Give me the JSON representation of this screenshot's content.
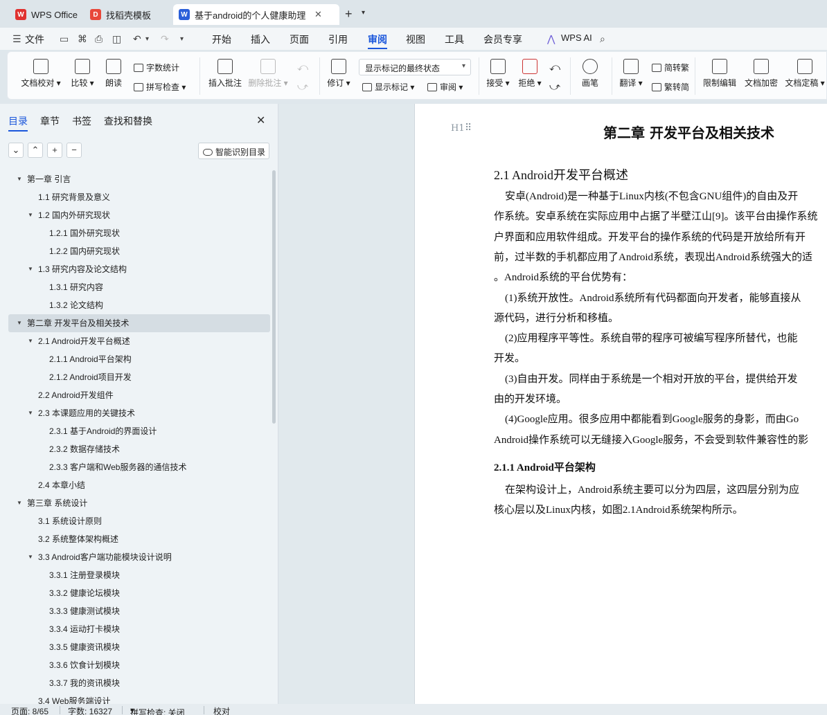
{
  "tabs": [
    {
      "label": "WPS Office",
      "color": "#e0312f"
    },
    {
      "label": "找稻壳模板",
      "color": "#e8483a"
    },
    {
      "label": "基于android的个人健康助理",
      "color": "#2b5fd9"
    }
  ],
  "menu": {
    "file": "文件",
    "items": [
      "开始",
      "插入",
      "页面",
      "引用",
      "审阅",
      "视图",
      "工具",
      "会员专享"
    ],
    "active": "审阅",
    "wps_ai": "WPS AI"
  },
  "ribbon": {
    "doc_check": "文档校对",
    "compare": "比较",
    "read_aloud": "朗读",
    "word_count": "字数统计",
    "spell_check": "拼写检查",
    "insert_comment": "插入批注",
    "delete_comment": "删除批注",
    "track_changes": "修订",
    "display_state": "显示标记的最终状态",
    "show_markup": "显示标记",
    "review": "审阅",
    "accept": "接受",
    "reject": "拒绝",
    "pen": "画笔",
    "translate": "翻译",
    "to_traditional": "简转繁",
    "to_simplified": "繁转简",
    "restrict_edit": "限制编辑",
    "encrypt": "文档加密",
    "finalize": "文档定稿"
  },
  "sidebar": {
    "tabs": [
      "目录",
      "章节",
      "书签",
      "查找和替换"
    ],
    "smart_toc": "智能识别目录",
    "toc": [
      {
        "label": "第一章  引言",
        "level": 1,
        "expand": true
      },
      {
        "label": "1.1  研究背景及意义",
        "level": 2,
        "expand": false
      },
      {
        "label": "1.2  国内外研究现状",
        "level": 2,
        "expand": true
      },
      {
        "label": "1.2.1  国外研究现状",
        "level": 3,
        "expand": false
      },
      {
        "label": "1.2.2  国内研究现状",
        "level": 3,
        "expand": false
      },
      {
        "label": "1.3  研究内容及论文结构",
        "level": 2,
        "expand": true
      },
      {
        "label": "1.3.1  研究内容",
        "level": 3,
        "expand": false
      },
      {
        "label": "1.3.2  论文结构",
        "level": 3,
        "expand": false
      },
      {
        "label": "第二章  开发平台及相关技术",
        "level": 1,
        "expand": true,
        "selected": true
      },
      {
        "label": "2.1 Android开发平台概述",
        "level": 2,
        "expand": true
      },
      {
        "label": "2.1.1 Android平台架构",
        "level": 3,
        "expand": false
      },
      {
        "label": "2.1.2 Android项目开发",
        "level": 3,
        "expand": false
      },
      {
        "label": "2.2 Android开发组件",
        "level": 2,
        "expand": false
      },
      {
        "label": "2.3  本课题应用的关键技术",
        "level": 2,
        "expand": true
      },
      {
        "label": "2.3.1  基于Android的界面设计",
        "level": 3,
        "expand": false
      },
      {
        "label": "2.3.2  数据存储技术",
        "level": 3,
        "expand": false
      },
      {
        "label": "2.3.3  客户端和Web服务器的通信技术",
        "level": 3,
        "expand": false
      },
      {
        "label": "2.4  本章小结",
        "level": 2,
        "expand": false
      },
      {
        "label": "第三章  系统设计",
        "level": 1,
        "expand": true
      },
      {
        "label": "3.1  系统设计原则",
        "level": 2,
        "expand": false
      },
      {
        "label": "3.2  系统整体架构概述",
        "level": 2,
        "expand": false
      },
      {
        "label": "3.3 Android客户端功能模块设计说明",
        "level": 2,
        "expand": true
      },
      {
        "label": "3.3.1  注册登录模块",
        "level": 3,
        "expand": false
      },
      {
        "label": "3.3.2  健康论坛模块",
        "level": 3,
        "expand": false
      },
      {
        "label": "3.3.3  健康测试模块",
        "level": 3,
        "expand": false
      },
      {
        "label": "3.3.4  运动打卡模块",
        "level": 3,
        "expand": false
      },
      {
        "label": "3.3.5  健康资讯模块",
        "level": 3,
        "expand": false
      },
      {
        "label": "3.3.6  饮食计划模块",
        "level": 3,
        "expand": false
      },
      {
        "label": "3.3.7  我的资讯模块",
        "level": 3,
        "expand": false
      },
      {
        "label": "3.4 Web服务端设计",
        "level": 2,
        "expand": false
      }
    ]
  },
  "document": {
    "heading_mark": "H1",
    "chapter_title": "第二章  开发平台及相关技术",
    "section_title": "2.1 Android开发平台概述",
    "lines": [
      "安卓(Android)是一种基于Linux内核(不包含GNU组件)的自由及开",
      "作系统。安卓系统在实际应用中占据了半壁江山[9]。该平台由操作系统",
      "户界面和应用软件组成。开发平台的操作系统的代码是开放给所有开",
      "前，过半数的手机都应用了Android系统，表现出Android系统强大的适",
      "。Android系统的平台优势有：",
      "(1)系统开放性。Android系统所有代码都面向开发者，能够直接从",
      "源代码，进行分析和移植。",
      "(2)应用程序平等性。系统自带的程序可被编写程序所替代，也能",
      "开发。",
      "(3)自由开发。同样由于系统是一个相对开放的平台，提供给开发",
      "由的开发环境。",
      "(4)Google应用。很多应用中都能看到Google服务的身影，而由Go",
      "Android操作系统可以无缝接入Google服务，不会受到软件兼容性的影"
    ],
    "subsection_title": "2.1.1 Android平台架构",
    "lines2": [
      "在架构设计上，Android系统主要可以分为四层，这四层分别为应",
      "核心层以及Linux内核，如图2.1Android系统架构所示。"
    ]
  },
  "status": {
    "page": "页面: 8/65",
    "words": "字数: 16327",
    "spell": "拼写检查: 关闭",
    "proof": "校对"
  }
}
